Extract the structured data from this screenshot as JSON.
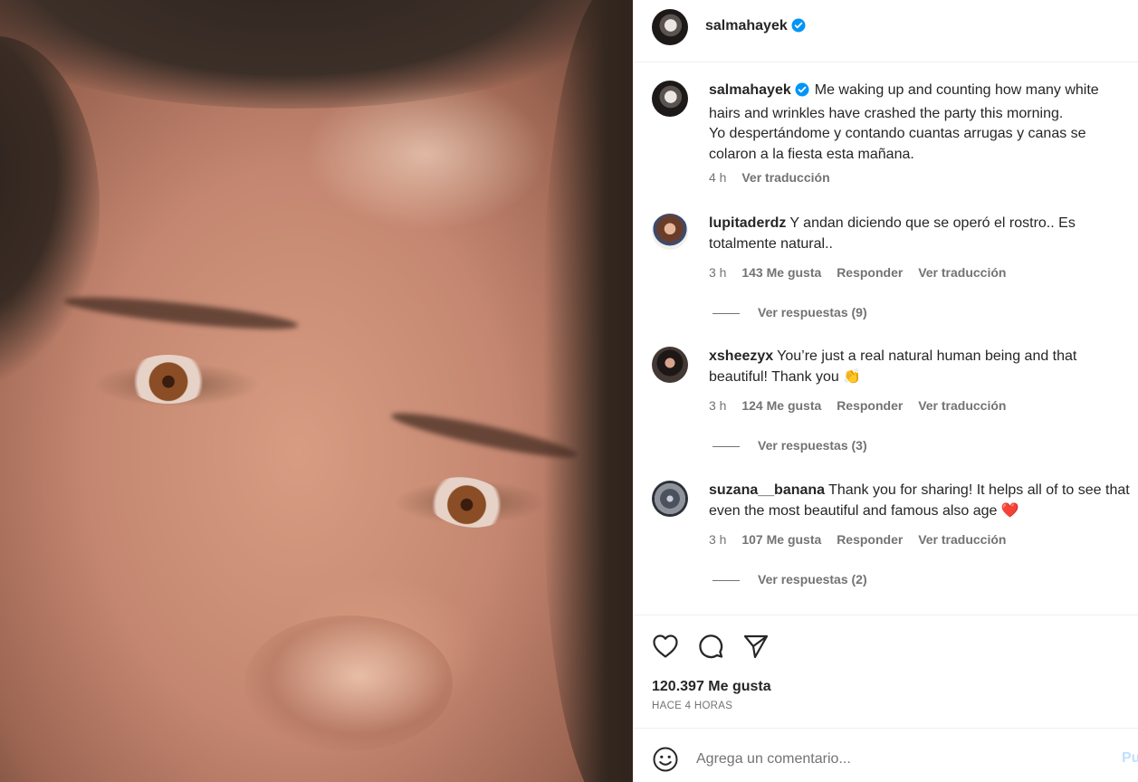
{
  "post": {
    "author": "salmahayek",
    "caption_lines": [
      "Me waking up and counting how many white",
      "hairs and wrinkles have crashed the party this morning.",
      "Yo despertándome y contando cuantas arrugas y canas se",
      "colaron a la fiesta esta mañana."
    ],
    "time": "4 h",
    "translate": "Ver traducción"
  },
  "comments": [
    {
      "user": "lupitaderdz",
      "text": "Y andan diciendo que se operó el rostro.. Es totalmente natural..",
      "time": "3 h",
      "likes": "143 Me gusta",
      "reply": "Responder",
      "translate": "Ver traducción",
      "replies": "Ver respuestas (9)"
    },
    {
      "user": "xsheezyx",
      "text": "You’re just a real natural human being and that beautiful! Thank you 👏",
      "time": "3 h",
      "likes": "124 Me gusta",
      "reply": "Responder",
      "translate": "Ver traducción",
      "replies": "Ver respuestas (3)"
    },
    {
      "user": "suzana__banana",
      "text": "Thank you for sharing! It helps all of to see that even the most beautiful and famous also age ❤️",
      "time": "3 h",
      "likes": "107 Me gusta",
      "reply": "Responder",
      "translate": "Ver traducción",
      "replies": "Ver respuestas (2)"
    }
  ],
  "actions": {
    "like_icon": "heart-outline",
    "comment_icon": "speech-bubble",
    "share_icon": "paper-plane"
  },
  "stats": {
    "likes": "120.397 Me gusta",
    "ago": "HACE 4 HORAS"
  },
  "add_comment": {
    "placeholder": "Agrega un comentario...",
    "post_label": "Pu"
  },
  "colors": {
    "verified": "#0095f6",
    "muted": "#737373",
    "text": "#262626",
    "post_disabled": "#c0dffd"
  }
}
